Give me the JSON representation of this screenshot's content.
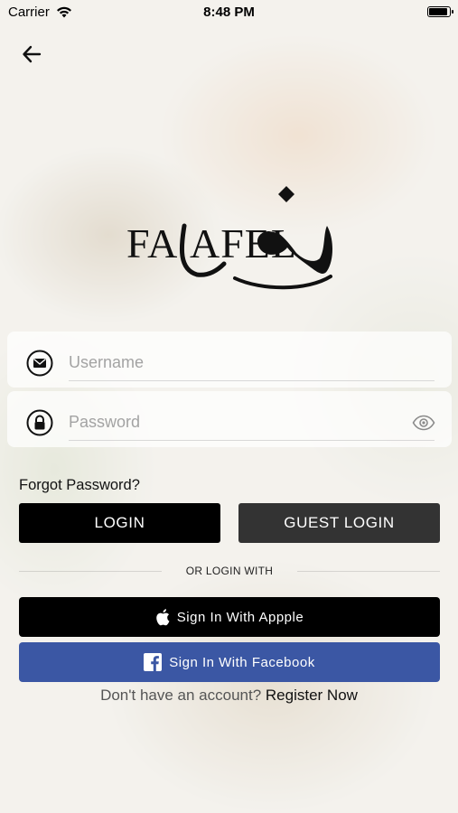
{
  "status_bar": {
    "carrier": "Carrier",
    "time": "8:48 PM"
  },
  "logo": {
    "text": "FALAFEL"
  },
  "form": {
    "username_placeholder": "Username",
    "password_placeholder": "Password"
  },
  "links": {
    "forgot_password": "Forgot Password?"
  },
  "buttons": {
    "login": "LOGIN",
    "guest_login": "GUEST LOGIN",
    "apple": "Sign In With Appple",
    "facebook": "Sign In With Facebook"
  },
  "divider_text": "OR LOGIN WITH",
  "register": {
    "question": "Don't have an account?",
    "link": "Register Now"
  },
  "icons": {
    "back": "arrow-left-icon",
    "username": "envelope-icon",
    "password": "lock-icon",
    "toggle": "eye-icon",
    "apple": "apple-icon",
    "facebook": "facebook-icon"
  },
  "colors": {
    "primary": "#000000",
    "guest": "#333333",
    "facebook": "#3b57a4"
  }
}
